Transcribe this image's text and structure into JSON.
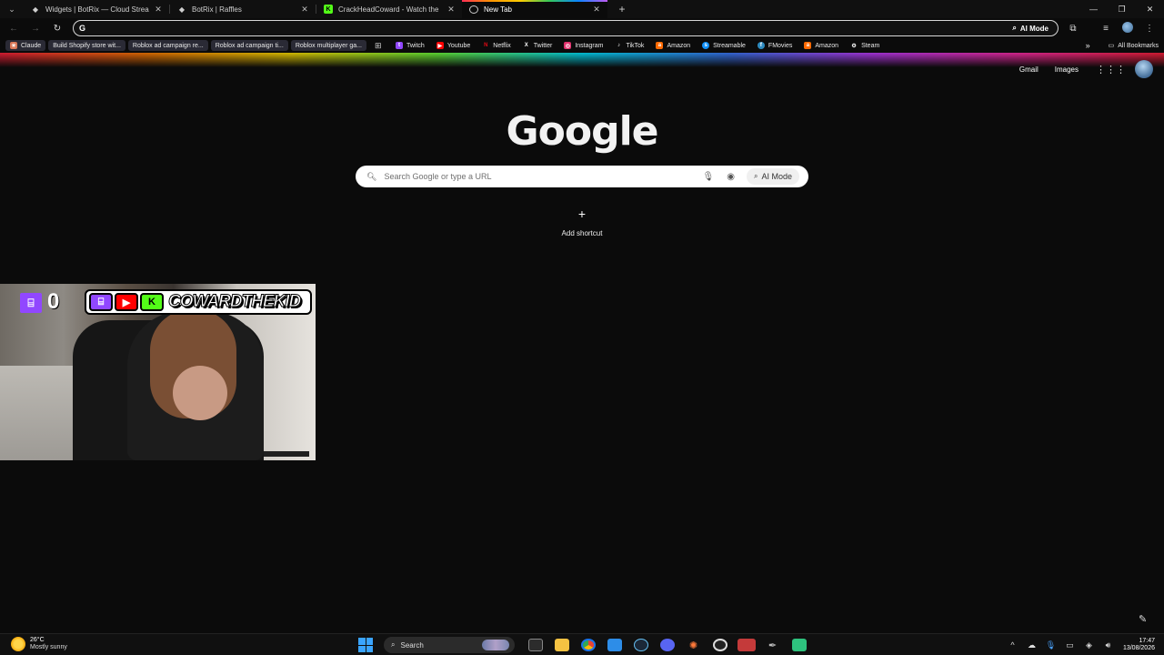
{
  "tabs": [
    {
      "title": "Widgets | BotRix — Cloud Strea",
      "favicon": "botrix-icon",
      "active": false
    },
    {
      "title": "BotRix | Raffles",
      "favicon": "botrix-icon",
      "active": false
    },
    {
      "title": "CrackHeadCoward - Watch the",
      "favicon": "kick-icon",
      "active": false
    },
    {
      "title": "New Tab",
      "favicon": "chrome-icon",
      "active": true
    }
  ],
  "address_bar": {
    "value": "",
    "ai_mode_label": "AI Mode"
  },
  "bookmarks": [
    {
      "label": "Claude",
      "icon_color": "#d97757",
      "pill": true
    },
    {
      "label": "Build Shopify store wit...",
      "icon_color": "#5a5a6a",
      "pill": true
    },
    {
      "label": "Roblox ad campaign re...",
      "icon_color": "#5a5a6a",
      "pill": true
    },
    {
      "label": "Roblox ad campaign ti...",
      "icon_color": "#5a5a6a",
      "pill": true
    },
    {
      "label": "Roblox multiplayer ga...",
      "icon_color": "#5a5a6a",
      "pill": true
    }
  ],
  "bookmarks_sites": [
    {
      "label": "Twitch",
      "icon_color": "#9147ff",
      "glyph": "t"
    },
    {
      "label": "Youtube",
      "icon_color": "#ff0000",
      "glyph": "▶"
    },
    {
      "label": "Netflix",
      "icon_color": "#e50914",
      "glyph": "N"
    },
    {
      "label": "Twitter",
      "icon_color": "#222222",
      "glyph": "X"
    },
    {
      "label": "Instagram",
      "icon_color": "#e1306c",
      "glyph": "◎"
    },
    {
      "label": "TikTok",
      "icon_color": "#111111",
      "glyph": "♪"
    },
    {
      "label": "Amazon",
      "icon_color": "#ff9900",
      "glyph": "a"
    },
    {
      "label": "Streamable",
      "icon_color": "#0f90fa",
      "glyph": "s"
    },
    {
      "label": "FMovies",
      "icon_color": "#2e8bc0",
      "glyph": "f"
    },
    {
      "label": "Amazon",
      "icon_color": "#ff9900",
      "glyph": "a"
    },
    {
      "label": "Steam",
      "icon_color": "#1b2838",
      "glyph": "S"
    }
  ],
  "all_bookmarks_label": "All Bookmarks",
  "ntp": {
    "gmail": "Gmail",
    "images": "Images",
    "logo": "Google",
    "search_placeholder": "Search Google or type a URL",
    "ai_mode": "AI Mode",
    "add_shortcut": "Add shortcut"
  },
  "webcam": {
    "viewer_count": "0",
    "channel_name": "COWARDTHEKID"
  },
  "taskbar": {
    "weather_temp": "26°C",
    "weather_desc": "Mostly sunny",
    "search_label": "Search",
    "time": "17:47",
    "date": "13/08/2026"
  },
  "colors": {
    "accent_blue": "#3aa4ff",
    "twitch_purple": "#9147ff",
    "kick_green": "#53fc18"
  }
}
